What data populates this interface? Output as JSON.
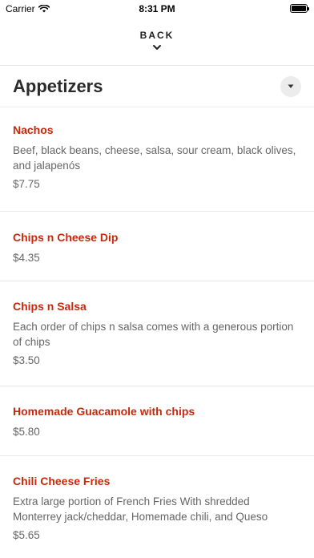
{
  "status_bar": {
    "carrier": "Carrier",
    "time": "8:31 PM"
  },
  "nav": {
    "back_label": "BACK"
  },
  "section": {
    "title": "Appetizers"
  },
  "items": [
    {
      "name": "Nachos",
      "description": "Beef, black beans, cheese, salsa, sour cream, black olives, and jalapenós",
      "price": "$7.75"
    },
    {
      "name": "Chips n Cheese Dip",
      "description": "",
      "price": "$4.35"
    },
    {
      "name": "Chips n Salsa",
      "description": "Each order of chips n salsa comes with a generous portion of chips",
      "price": "$3.50"
    },
    {
      "name": "Homemade Guacamole with chips",
      "description": "",
      "price": "$5.80"
    },
    {
      "name": "Chili Cheese Fries",
      "description": "Extra large portion of French Fries With shredded Monterrey jack/cheddar, Homemade chili, and Queso",
      "price": "$5.65"
    }
  ]
}
